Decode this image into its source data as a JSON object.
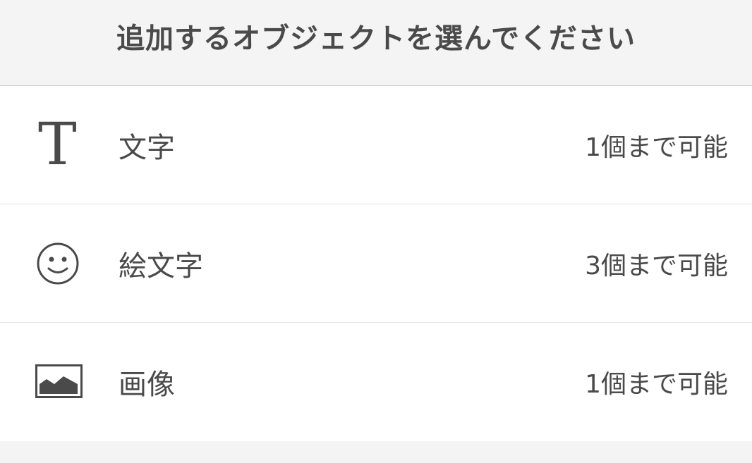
{
  "header": {
    "title": "追加するオブジェクトを選んでください"
  },
  "items": [
    {
      "icon": "text-icon",
      "glyph": "T",
      "label": "文字",
      "limit": "1個まで可能"
    },
    {
      "icon": "smiley-icon",
      "label": "絵文字",
      "limit": "3個まで可能"
    },
    {
      "icon": "image-icon",
      "label": "画像",
      "limit": "1個まで可能"
    }
  ],
  "colors": {
    "header_bg": "#f4f4f4",
    "list_bg": "#ffffff",
    "text": "#4a4a4a",
    "divider": "#e3e3e3"
  }
}
